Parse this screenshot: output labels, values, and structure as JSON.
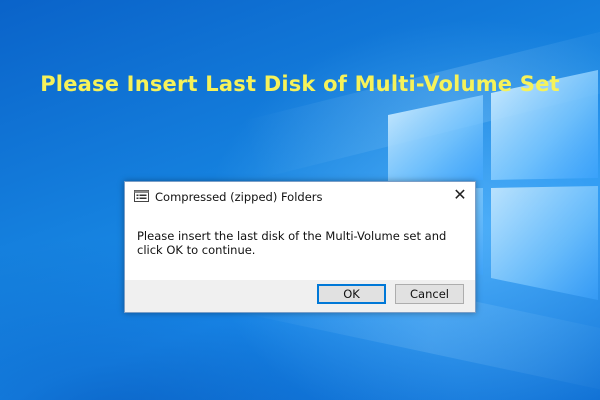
{
  "headline": "Please Insert Last Disk of Multi-Volume Set",
  "dialog": {
    "title": "Compressed (zipped) Folders",
    "close_glyph": "✕",
    "message": "Please insert the last disk of the Multi-Volume set and click OK to continue.",
    "buttons": {
      "ok": "OK",
      "cancel": "Cancel"
    }
  },
  "colors": {
    "headline": "#f6f25a",
    "desktop": "#1683e0",
    "focus_border": "#0078d7"
  },
  "icons": {
    "app": "window-list-icon",
    "close": "close-icon",
    "wallpaper": "windows-logo-icon"
  }
}
